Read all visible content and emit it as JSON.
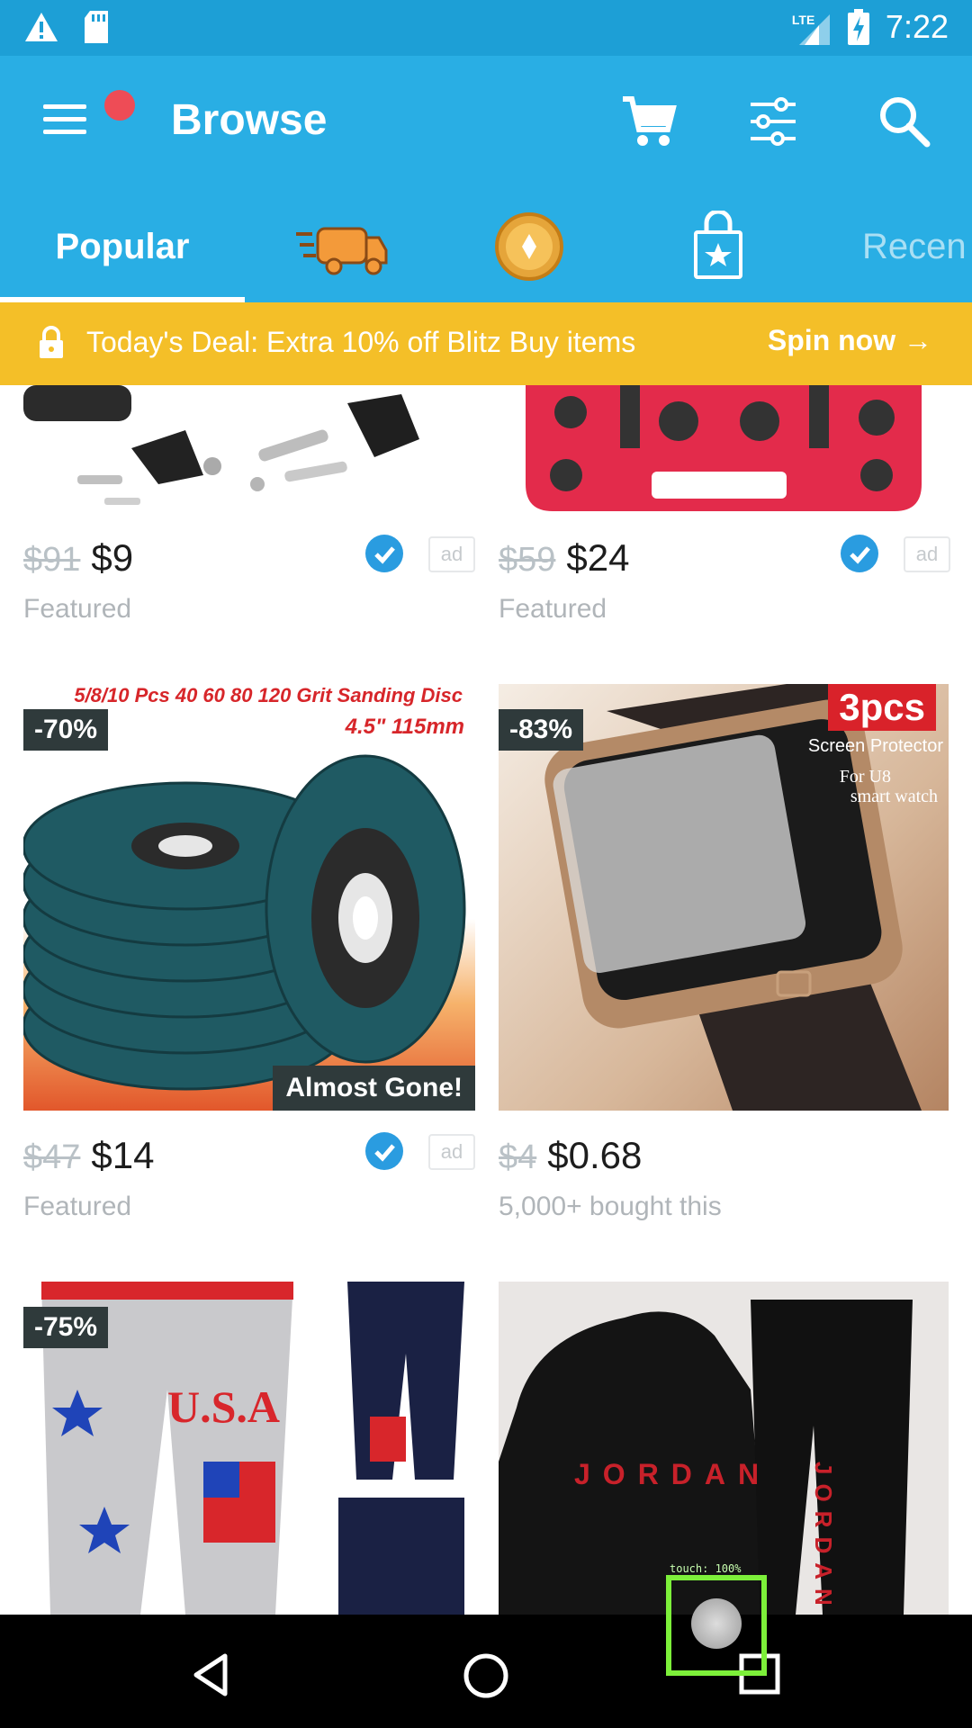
{
  "status_bar": {
    "time": "7:22",
    "network": "LTE"
  },
  "header": {
    "title": "Browse"
  },
  "tabs": [
    {
      "label": "Popular",
      "selected": true
    },
    {
      "icon": "truck-icon"
    },
    {
      "icon": "coin-icon"
    },
    {
      "icon": "shopping-bag-icon"
    },
    {
      "label": "Recen"
    }
  ],
  "deal": {
    "text": "Today's Deal: Extra 10% off Blitz Buy items",
    "cta": "Spin now →"
  },
  "products": [
    {
      "old_price": "$91",
      "price": "$9",
      "subtext": "Featured",
      "ad": "ad",
      "verified": true
    },
    {
      "old_price": "$59",
      "price": "$24",
      "subtext": "Featured",
      "ad": "ad",
      "verified": true
    },
    {
      "old_price": "$47",
      "price": "$14",
      "subtext": "Featured",
      "ad": "ad",
      "verified": true,
      "discount": "-70%",
      "badge": "Almost Gone!",
      "image_text": {
        "line1": "5/8/10 Pcs 40 60 80 120 Grit Sanding Disc",
        "line2": "4.5\" 115mm"
      }
    },
    {
      "old_price": "$4",
      "price": "$0.68",
      "subtext": "5,000+ bought this",
      "discount": "-83%",
      "image_text": {
        "line1": "3pcs",
        "line2": "Screen Protector",
        "line3": "For U8",
        "line4": "smart watch"
      }
    },
    {
      "discount": "-75%",
      "image_text": {
        "line1": "U.S.A"
      }
    },
    {
      "image_text": {
        "line1": "JORDAN",
        "line2": "JORDAN"
      }
    }
  ],
  "touch_indicator": {
    "label": "touch: 100%"
  },
  "colors": {
    "primary": "#29aee4",
    "status": "#1d9fd6",
    "deal": "#f4bf28",
    "badge": "#2f3a3b",
    "verified": "#2a9ce0"
  }
}
